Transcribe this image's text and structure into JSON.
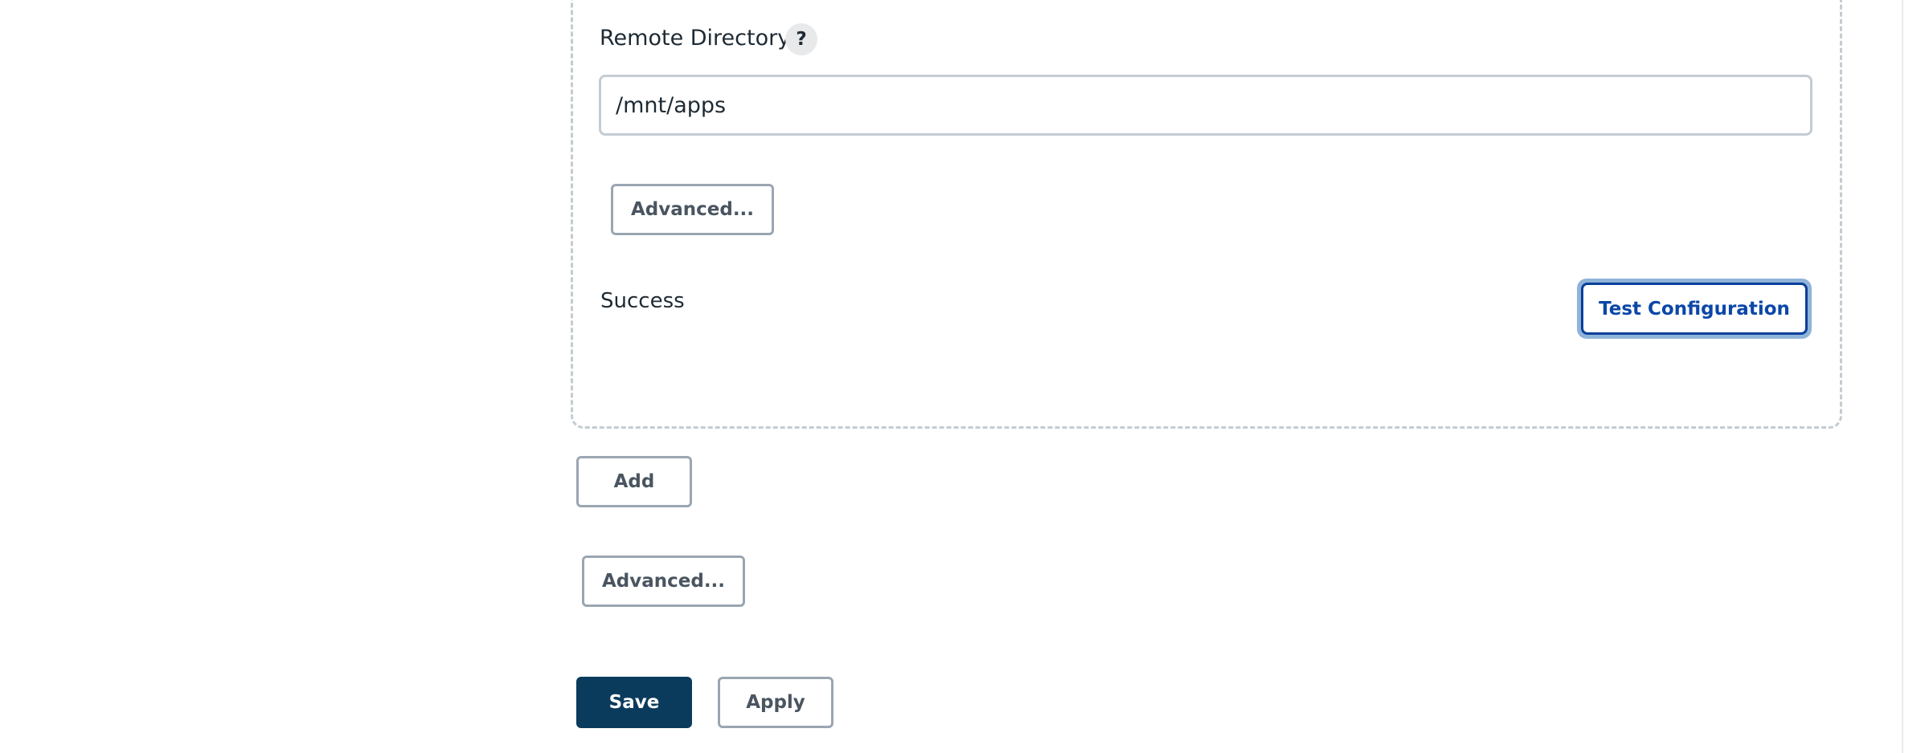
{
  "remote_directory": {
    "label": "Remote Directory",
    "help_icon": "?",
    "value": "/mnt/apps"
  },
  "server_advanced_label": "Advanced...",
  "connection_status": "Success",
  "test_configuration_label": "Test Configuration",
  "add_label": "Add",
  "advanced_label": "Advanced...",
  "actions": {
    "save_label": "Save",
    "apply_label": "Apply"
  },
  "colors": {
    "primary": "#0b3b5c",
    "link_blue": "#0b47a8",
    "focus_ring": "#8fb4d9",
    "border_gray": "#9aa6b1"
  }
}
